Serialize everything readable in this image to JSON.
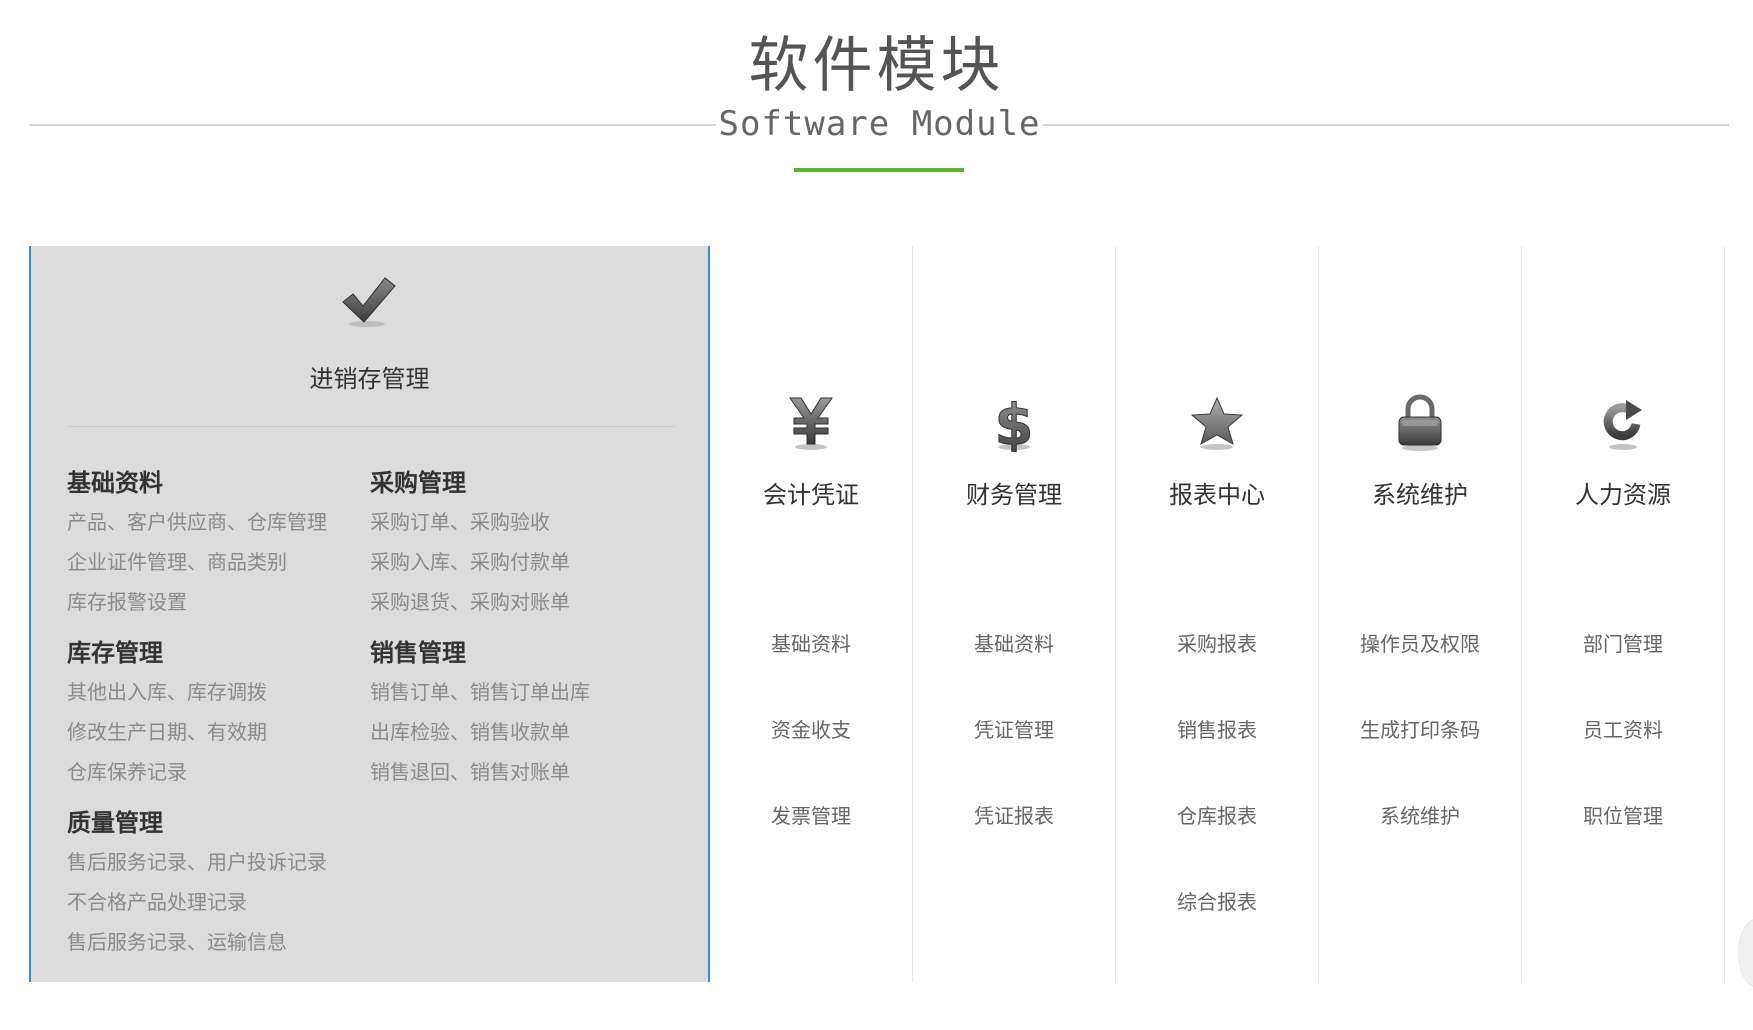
{
  "header": {
    "title_cn": "软件模块",
    "title_en": "Software Module"
  },
  "featured": {
    "icon": "checkmark-icon",
    "title": "进销存管理",
    "groups": [
      {
        "title": "基础资料",
        "lines": [
          "产品、客户供应商、仓库管理",
          "企业证件管理、商品类别",
          "库存报警设置"
        ]
      },
      {
        "title": "采购管理",
        "lines": [
          "采购订单、采购验收",
          "采购入库、采购付款单",
          "采购退货、采购对账单"
        ]
      },
      {
        "title": "库存管理",
        "lines": [
          "其他出入库、库存调拨",
          "修改生产日期、有效期",
          "仓库保养记录"
        ]
      },
      {
        "title": "销售管理",
        "lines": [
          "销售订单、销售订单出库",
          "出库检验、销售收款单",
          "销售退回、销售对账单"
        ]
      },
      {
        "title": "质量管理",
        "lines": [
          "售后服务记录、用户投诉记录",
          "不合格产品处理记录",
          "售后服务记录、运输信息"
        ]
      }
    ]
  },
  "modules": [
    {
      "icon": "yen-icon",
      "title": "会计凭证",
      "items": [
        "基础资料",
        "资金收支",
        "发票管理"
      ]
    },
    {
      "icon": "dollar-icon",
      "title": "财务管理",
      "items": [
        "基础资料",
        "凭证管理",
        "凭证报表"
      ]
    },
    {
      "icon": "star-icon",
      "title": "报表中心",
      "items": [
        "采购报表",
        "销售报表",
        "仓库报表",
        "综合报表"
      ]
    },
    {
      "icon": "lock-icon",
      "title": "系统维护",
      "items": [
        "操作员及权限",
        "生成打印条码",
        "系统维护"
      ]
    },
    {
      "icon": "refresh-icon",
      "title": "人力资源",
      "items": [
        "部门管理",
        "员工资料",
        "职位管理"
      ]
    }
  ],
  "colors": {
    "accent_green": "#5bb236",
    "panel_border_blue": "#2d8fd6",
    "panel_bg": "#dcdcdc"
  }
}
